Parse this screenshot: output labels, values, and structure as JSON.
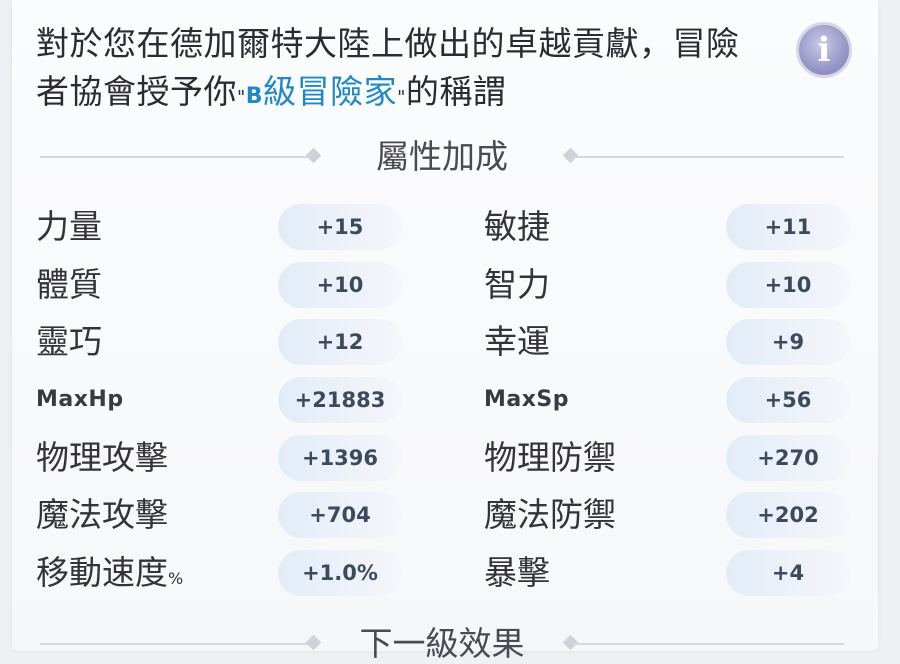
{
  "description": {
    "line1": "對於您在德加爾特大陸上做出的卓越貢獻，冒險",
    "line2_prefix": "者協會授予你",
    "quote_open": "\"",
    "title_letter": "B",
    "title_rest": "級冒險家",
    "quote_close": "\"",
    "line2_suffix": "的稱謂"
  },
  "info_button": {
    "glyph": "i",
    "icon": "info-icon"
  },
  "attribute_section": {
    "title": "屬性加成"
  },
  "stats": [
    {
      "left_label": "力量",
      "left_value": "+15",
      "right_label": "敏捷",
      "right_value": "+11"
    },
    {
      "left_label": "體質",
      "left_value": "+10",
      "right_label": "智力",
      "right_value": "+10"
    },
    {
      "left_label": "靈巧",
      "left_value": "+12",
      "right_label": "幸運",
      "right_value": "+9"
    },
    {
      "left_label": "MaxHp",
      "left_value": "+21883",
      "right_label": "MaxSp",
      "right_value": "+56"
    },
    {
      "left_label": "物理攻擊",
      "left_value": "+1396",
      "right_label": "物理防禦",
      "right_value": "+270"
    },
    {
      "left_label": "魔法攻擊",
      "left_value": "+704",
      "right_label": "魔法防禦",
      "right_value": "+202"
    },
    {
      "left_label": "移動速度",
      "left_label_suffix": "%",
      "left_value": "+1.0%",
      "right_label": "暴擊",
      "right_value": "+4"
    }
  ],
  "next_section": {
    "title": "下一級效果"
  },
  "colors": {
    "highlight": "#1f88c6",
    "info_button": "#9b9bc9",
    "pill": "#e2ecf8"
  }
}
